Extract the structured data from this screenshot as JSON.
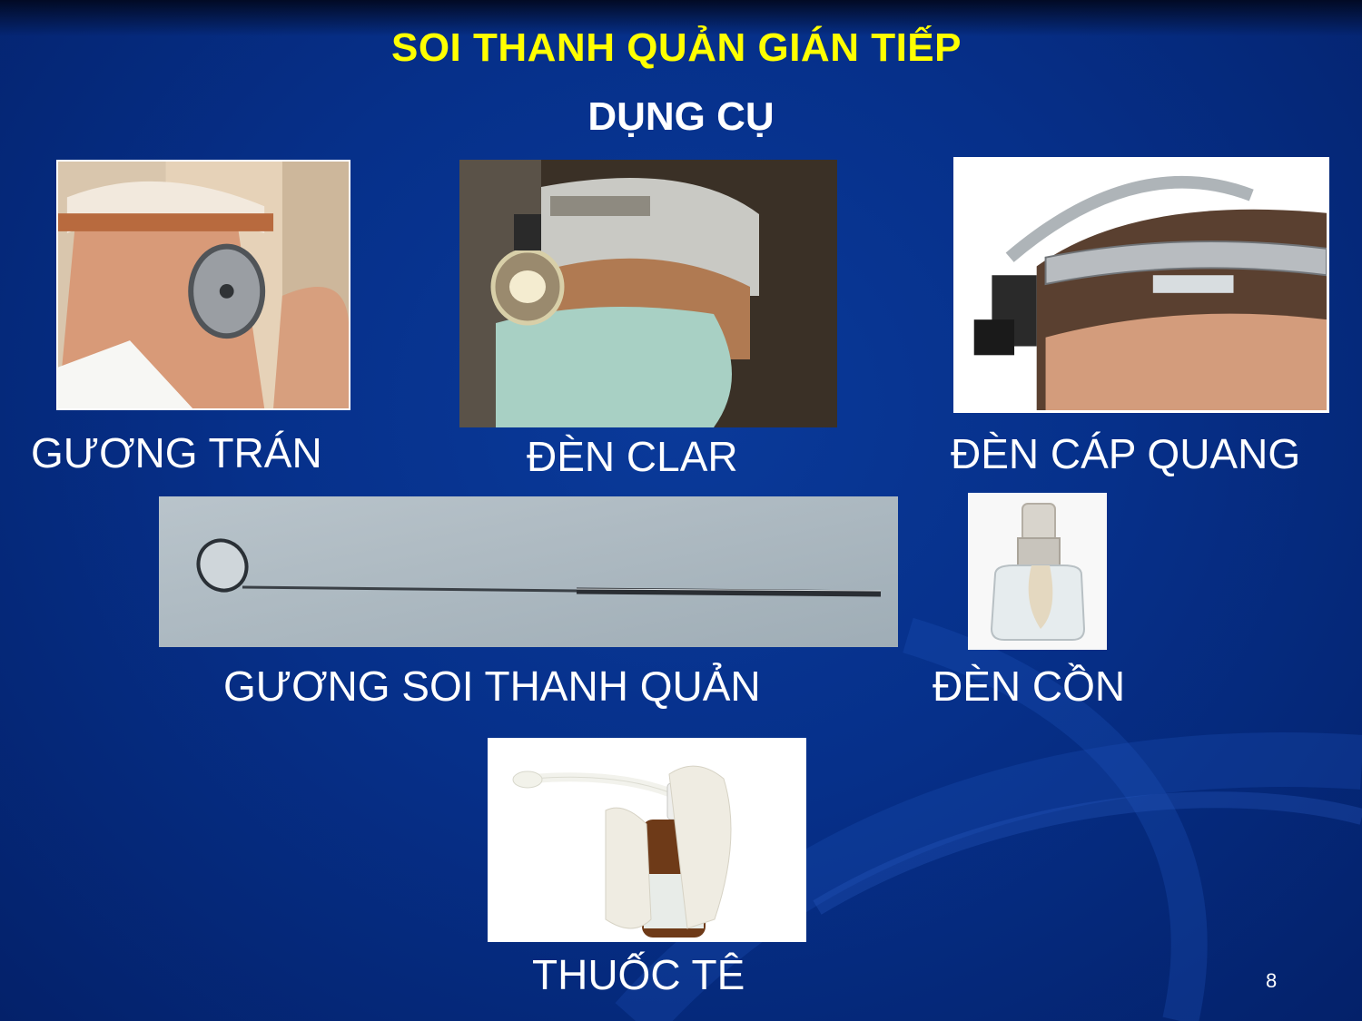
{
  "slide": {
    "title": "SOI THANH QUẢN GIÁN TIẾP",
    "subtitle": "DỤNG CỤ",
    "page_number": "8"
  },
  "instruments": {
    "head_mirror": {
      "label": "GƯƠNG TRÁN"
    },
    "clar_lamp": {
      "label": "ĐÈN CLAR"
    },
    "fiber_optic_lamp": {
      "label": "ĐÈN CÁP QUANG"
    },
    "laryngeal_mirror": {
      "label": "GƯƠNG SOI THANH QUẢN"
    },
    "alcohol_lamp": {
      "label": "ĐÈN CỒN"
    },
    "anesthetic_spray": {
      "label": "THUỐC TÊ"
    }
  },
  "colors": {
    "background": "#06308a",
    "title": "#ffff00",
    "text": "#ffffff"
  }
}
